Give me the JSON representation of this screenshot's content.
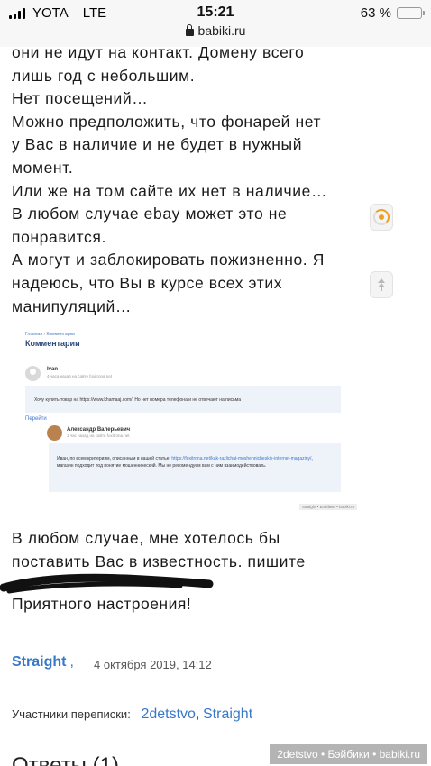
{
  "status_bar": {
    "carrier": "YOTA",
    "network": "LTE",
    "time": "15:21",
    "battery_percent": "63 %",
    "battery_level": 0.63,
    "battery_color": "#f2c200",
    "url": "babiki.ru",
    "lock_icon": "lock-icon"
  },
  "message": {
    "lines": [
      "они не идут на контакт. Домену всего",
      "лишь год с небольшим.",
      "Нет посещений…",
      "Можно предположить, что фонарей нет",
      "у Вас в наличие и не будет в нужный",
      "момент.",
      "Или же на том сайте их нет в наличие…",
      "В любом случае ebay может это не",
      "понравится.",
      "А могут и заблокировать пожизненно. Я",
      "надеюсь, что Вы в курсе всех этих",
      "манипуляций…"
    ],
    "after_lines": [
      "В любом случае, мне хотелось бы",
      "поставить Вас в известность. пишите",
      "mi"
    ],
    "closing": "Приятного настроения!"
  },
  "embed": {
    "breadcrumb": "Главная › Комментарии",
    "title": "Комментарии",
    "comment1": {
      "author": "Ivan",
      "date": "4 часа назад на сайте foxitrona.net",
      "text": "Хочу купить товар на https://www.khamaaj.com/. Но нет номера телефона и не отвечают на письма"
    },
    "reply_label": "Перейти",
    "comment2": {
      "author": "Александр Валерьевич",
      "date": "1 час назад на сайте foxitrona.net",
      "text_before": "Иван, по всем критериям, описанным в нашей статье: ",
      "link": "https://foxitrona.net/kak-razlichat-moshennicheskie-internet-magaziny/",
      "text_after": ", магазин подходит под понятие мошеннический. Мы не рекомендуем вам с ним взаимодействовать."
    },
    "watermark": "Straight • Бэйбики • babiki.ru"
  },
  "post": {
    "author": "Straight",
    "separator": ",",
    "date": "4 октября 2019, 14:12"
  },
  "participants": {
    "label": "Участники переписки:",
    "users": [
      "2detstvo",
      "Straight"
    ],
    "separator": ","
  },
  "replies_heading": "Ответы (1)",
  "watermark": "2detstvo • Бэйбики • babiki.ru",
  "icons": {
    "loader": "loading-spinner-icon",
    "scroll_up": "scroll-arrows-icon"
  }
}
